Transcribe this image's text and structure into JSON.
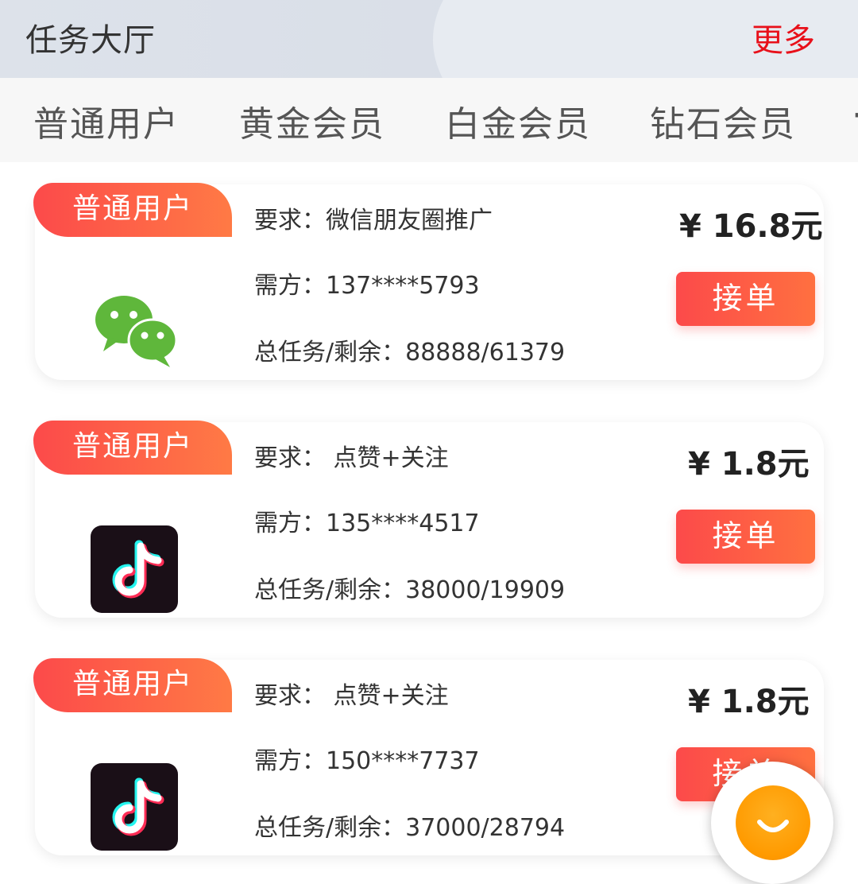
{
  "header": {
    "title": "任务大厅",
    "more_label": "更多"
  },
  "tabs": [
    {
      "label": "普通用户"
    },
    {
      "label": "黄金会员"
    },
    {
      "label": "白金会员"
    },
    {
      "label": "钻石会员"
    }
  ],
  "tasks": [
    {
      "badge": "普通用户",
      "app_icon": "wechat-icon",
      "requirement_label": "要求：",
      "requirement": "微信朋友圈推广",
      "buyer_label": "需方：",
      "buyer": "137****5793",
      "total_label": "总任务/剩余：",
      "total": "88888/61379",
      "price": "¥ 16.8元",
      "action_label": "接单"
    },
    {
      "badge": "普通用户",
      "app_icon": "tiktok-icon",
      "requirement_label": "要求：",
      "requirement": " 点赞+关注",
      "buyer_label": "需方：",
      "buyer": "135****4517",
      "total_label": "总任务/剩余：",
      "total": "38000/19909",
      "price": "¥ 1.8元",
      "action_label": "接单"
    },
    {
      "badge": "普通用户",
      "app_icon": "tiktok-icon",
      "requirement_label": "要求：",
      "requirement": " 点赞+关注",
      "buyer_label": "需方：",
      "buyer": "150****7737",
      "total_label": "总任务/剩余：",
      "total": "37000/28794",
      "price": "¥ 1.8元",
      "action_label": "接单"
    }
  ],
  "floating_button": {
    "icon": "chat-face-icon"
  },
  "colors": {
    "accent_red": "#e8101a",
    "badge_gradient_start": "#fc4a4a",
    "badge_gradient_end": "#ff7a45",
    "float_orange": "#ff9a00",
    "wechat_green": "#5fb73b"
  }
}
